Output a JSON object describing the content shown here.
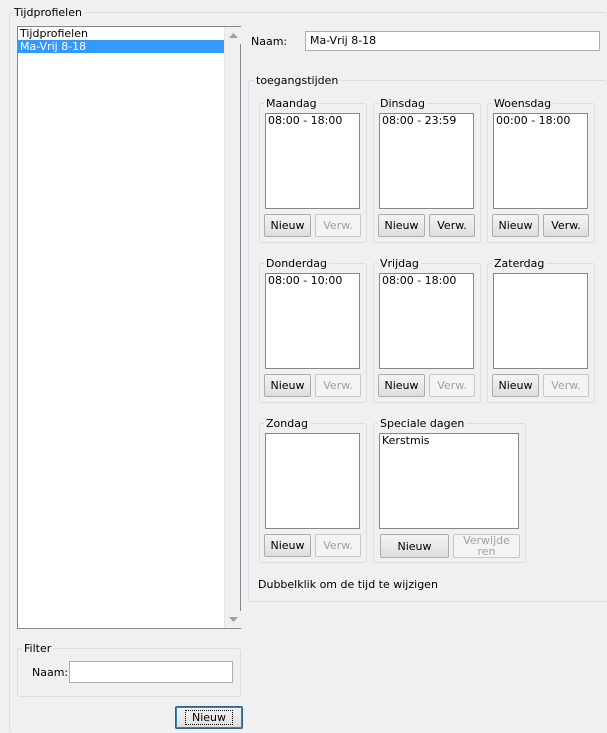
{
  "profiles": {
    "legend": "Tijdprofielen",
    "list_items": [
      "Tijdprofielen",
      "Ma-Vrij 8-18"
    ],
    "selected_index": 1
  },
  "filter": {
    "legend": "Filter",
    "name_label": "Naam:",
    "name_value": ""
  },
  "new_profile_button": "Nieuw",
  "detail": {
    "name_label": "Naam:",
    "name_value": "Ma-Vrij 8-18",
    "access_legend": "toegangstijden",
    "days": [
      {
        "label": "Maandag",
        "items": [
          "08:00 - 18:00"
        ],
        "new_label": "Nieuw",
        "delete_label": "Verw.",
        "delete_enabled": false
      },
      {
        "label": "Dinsdag",
        "items": [
          "08:00 - 23:59"
        ],
        "new_label": "Nieuw",
        "delete_label": "Verw.",
        "delete_enabled": true
      },
      {
        "label": "Woensdag",
        "items": [
          "00:00 - 18:00"
        ],
        "new_label": "Nieuw",
        "delete_label": "Verw.",
        "delete_enabled": true
      },
      {
        "label": "Donderdag",
        "items": [
          "08:00 - 10:00"
        ],
        "new_label": "Nieuw",
        "delete_label": "Verw.",
        "delete_enabled": false
      },
      {
        "label": "Vrijdag",
        "items": [
          "08:00 - 18:00"
        ],
        "new_label": "Nieuw",
        "delete_label": "Verw.",
        "delete_enabled": false
      },
      {
        "label": "Zaterdag",
        "items": [],
        "new_label": "Nieuw",
        "delete_label": "Verw.",
        "delete_enabled": false
      },
      {
        "label": "Zondag",
        "items": [],
        "new_label": "Nieuw",
        "delete_label": "Verw.",
        "delete_enabled": false
      }
    ],
    "special": {
      "label": "Speciale dagen",
      "items": [
        "Kerstmis"
      ],
      "new_label": "Nieuw",
      "delete_label": "Verwijderen",
      "delete_enabled": false
    },
    "hint": "Dubbelklik om de tijd te wijzigen"
  },
  "colors": {
    "selection": "#3399ff",
    "selection_text": "#ffffff",
    "group_border": "#d5dfe5",
    "background": "#f0f0f0"
  }
}
